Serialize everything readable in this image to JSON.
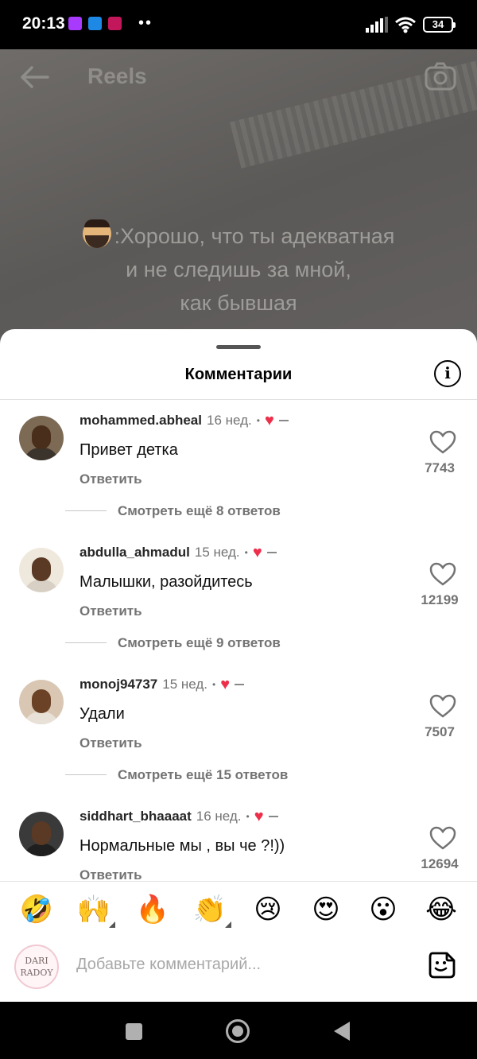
{
  "status_bar": {
    "time": "20:13",
    "battery": "34",
    "dots": "••"
  },
  "reel": {
    "title": "Reels",
    "caption_lines": [
      ":Хорошо, что ты адекватная",
      "и не следишь за мной,",
      "как бывшая"
    ]
  },
  "sheet": {
    "title": "Комментарии",
    "info_label": "i"
  },
  "comments": [
    {
      "user": "mohammed.abheal",
      "time": "16 нед.",
      "dot": "•",
      "text": "Привет детка",
      "reply": "Ответить",
      "likes": "7743",
      "more": "Смотреть ещё 8 ответов"
    },
    {
      "user": "abdulla_ahmadul",
      "time": "15 нед.",
      "dot": "•",
      "text": "Малышки, разойдитесь",
      "reply": "Ответить",
      "likes": "12199",
      "more": "Смотреть ещё 9 ответов"
    },
    {
      "user": "monoj94737",
      "time": "15 нед.",
      "dot": "•",
      "text": "Удали",
      "reply": "Ответить",
      "likes": "7507",
      "more": "Смотреть ещё 15 ответов"
    },
    {
      "user": "siddhart_bhaaaat",
      "time": "16 нед.",
      "dot": "•",
      "text": "Нормальные мы , вы че ?!))",
      "reply": "Ответить",
      "likes": "12694",
      "more": ""
    }
  ],
  "emojis": [
    "🤣",
    "🙌",
    "🔥",
    "👏",
    "😢",
    "😍",
    "😮",
    "😂"
  ],
  "input": {
    "placeholder": "Добавьте комментарий...",
    "avatar_text_1": "DARI",
    "avatar_text_2": "RADOY"
  },
  "colors": {
    "heart_red": "#ed2f4b",
    "muted_text": "#737373",
    "sheet_bg": "#ffffff"
  }
}
